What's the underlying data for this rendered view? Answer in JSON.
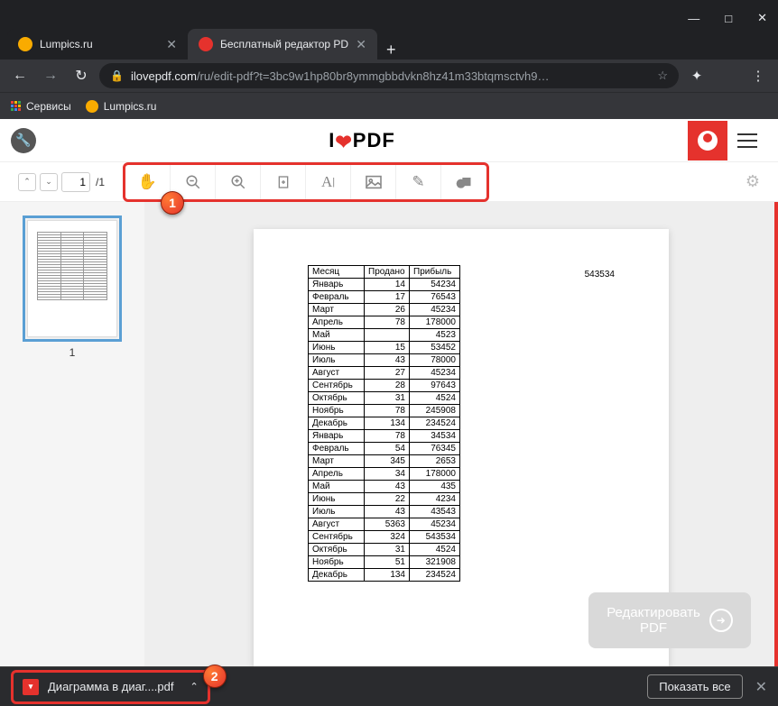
{
  "window": {
    "minimize": "—",
    "maximize": "□",
    "close": "✕"
  },
  "tabs": [
    {
      "title": "Lumpics.ru",
      "favColor": "#f9ab00"
    },
    {
      "title": "Бесплатный редактор PDF-файл",
      "favColor": "#e5322d"
    }
  ],
  "newtab": "+",
  "nav": {
    "back": "←",
    "forward": "→",
    "reload": "↻"
  },
  "address": {
    "domain": "ilovepdf.com",
    "path": "/ru/edit-pdf?t=3bc9w1hp80br8ymmgbbdvkn8hz41m33btqmsctvh9…"
  },
  "star": "☆",
  "ext": "✦",
  "menu": "⋮",
  "bookmarks": [
    {
      "label": "Сервисы"
    },
    {
      "label": "Lumpics.ru"
    }
  ],
  "logo": {
    "pre": "I",
    "post": "PDF"
  },
  "pagenav": {
    "current": "1",
    "total": "/1",
    "up": "⌃",
    "down": "⌄"
  },
  "tools": [
    "hand",
    "zoom-out",
    "zoom-in",
    "fit",
    "text",
    "image",
    "pencil",
    "shape"
  ],
  "gear": "⚙",
  "thumb": {
    "label": "1"
  },
  "sidecollapse": "‹",
  "doc": {
    "sidenum": "543534",
    "headers": [
      "Месяц",
      "Продано",
      "Прибыль"
    ],
    "rows": [
      [
        "Январь",
        "14",
        "54234"
      ],
      [
        "Февраль",
        "17",
        "76543"
      ],
      [
        "Март",
        "26",
        "45234"
      ],
      [
        "Апрель",
        "78",
        "178000"
      ],
      [
        "Май",
        "",
        "4523"
      ],
      [
        "Июнь",
        "15",
        "53452"
      ],
      [
        "Июль",
        "43",
        "78000"
      ],
      [
        "Август",
        "27",
        "45234"
      ],
      [
        "Сентябрь",
        "28",
        "97643"
      ],
      [
        "Октябрь",
        "31",
        "4524"
      ],
      [
        "Ноябрь",
        "78",
        "245908"
      ],
      [
        "Декабрь",
        "134",
        "234524"
      ],
      [
        "Январь",
        "78",
        "34534"
      ],
      [
        "Февраль",
        "54",
        "76345"
      ],
      [
        "Март",
        "345",
        "2653"
      ],
      [
        "Апрель",
        "34",
        "178000"
      ],
      [
        "Май",
        "43",
        "435"
      ],
      [
        "Июнь",
        "22",
        "4234"
      ],
      [
        "Июль",
        "43",
        "43543"
      ],
      [
        "Август",
        "5363",
        "45234"
      ],
      [
        "Сентябрь",
        "324",
        "543534"
      ],
      [
        "Октябрь",
        "31",
        "4524"
      ],
      [
        "Ноябрь",
        "51",
        "321908"
      ],
      [
        "Декабрь",
        "134",
        "234524"
      ]
    ]
  },
  "editbtn": {
    "line1": "Редактировать",
    "line2": "PDF",
    "arrow": "➜"
  },
  "download": {
    "file": "Диаграмма в диаг....pdf",
    "chev": "⌃",
    "showall": "Показать все",
    "close": "✕"
  },
  "markers": {
    "m1": "1",
    "m2": "2"
  }
}
